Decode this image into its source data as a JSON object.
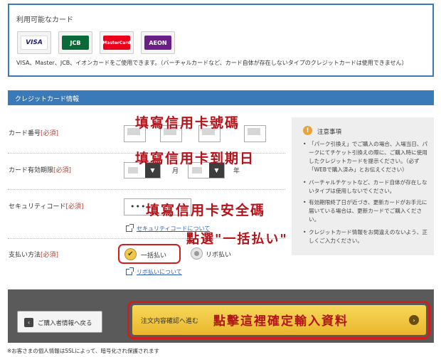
{
  "available_cards": {
    "title": "利用可能なカード",
    "logos": [
      {
        "name": "VISA",
        "color": "#1a1f71",
        "icon": "visa-logo"
      },
      {
        "name": "JCB",
        "color": "#0b6a3a",
        "icon": "jcb-logo"
      },
      {
        "name": "MasterCard",
        "color": "#eb001b",
        "icon": "mastercard-logo"
      },
      {
        "name": "AEON",
        "color": "#6a1f87",
        "icon": "aeon-logo"
      }
    ],
    "note": "VISA、Master、JCB、イオンカードをご使用できます。（バーチャルカードなど、カード自体が存在しないタイプのクレジットカードは使用できません）"
  },
  "section_title": "クレジットカード情報",
  "form": {
    "card_number": {
      "label": "カード番号",
      "required": "[必須]"
    },
    "expiry": {
      "label": "カード有効期限",
      "required": "[必須]",
      "month_unit": "月",
      "year_unit": "年"
    },
    "security_code": {
      "label": "セキュリティコード",
      "required": "[必須]",
      "value": "•••",
      "link": "セキュリティコードについて"
    },
    "payment_method": {
      "label": "支払い方法",
      "required": "[必須]",
      "options": [
        "一括払い",
        "リボ払い"
      ],
      "selected": "一括払い",
      "link": "リボ払いについて"
    }
  },
  "notes": {
    "title": "注意事項",
    "items": [
      "「パーク引換え」でご購入の場合、入場当日、パークにてチケット引換えの際に、ご購入時に使用したクレジットカードを提示ください。（必ず「WEBで購入済み」とお伝えください）",
      "バーチャルチケットなど、カード自体が存在しないタイプは使用しないでください。",
      "有効期限終了日が近づき、更新カードがお手元に届いている場合は、更新カードでご購入ください。",
      "クレジットカード情報をお間違えのないよう、正しくご入力ください。"
    ]
  },
  "buttons": {
    "back": "ご購入者情報へ戻る",
    "confirm": "注文内容確認へ進む"
  },
  "ssl_note": "※お客さまの個人情報はSSLによって、暗号化され保護されます",
  "annotations": {
    "card_number": "填寫信用卡號碼",
    "expiry": "填寫信用卡到期日",
    "security_code": "填寫信用卡安全碼",
    "payment": "點選\"一括払い\"",
    "confirm": "點擊這裡確定輸入資料"
  },
  "colors": {
    "accent": "#3a7ab8",
    "annotation": "#b3131a",
    "confirm_button": "#eab62c"
  }
}
